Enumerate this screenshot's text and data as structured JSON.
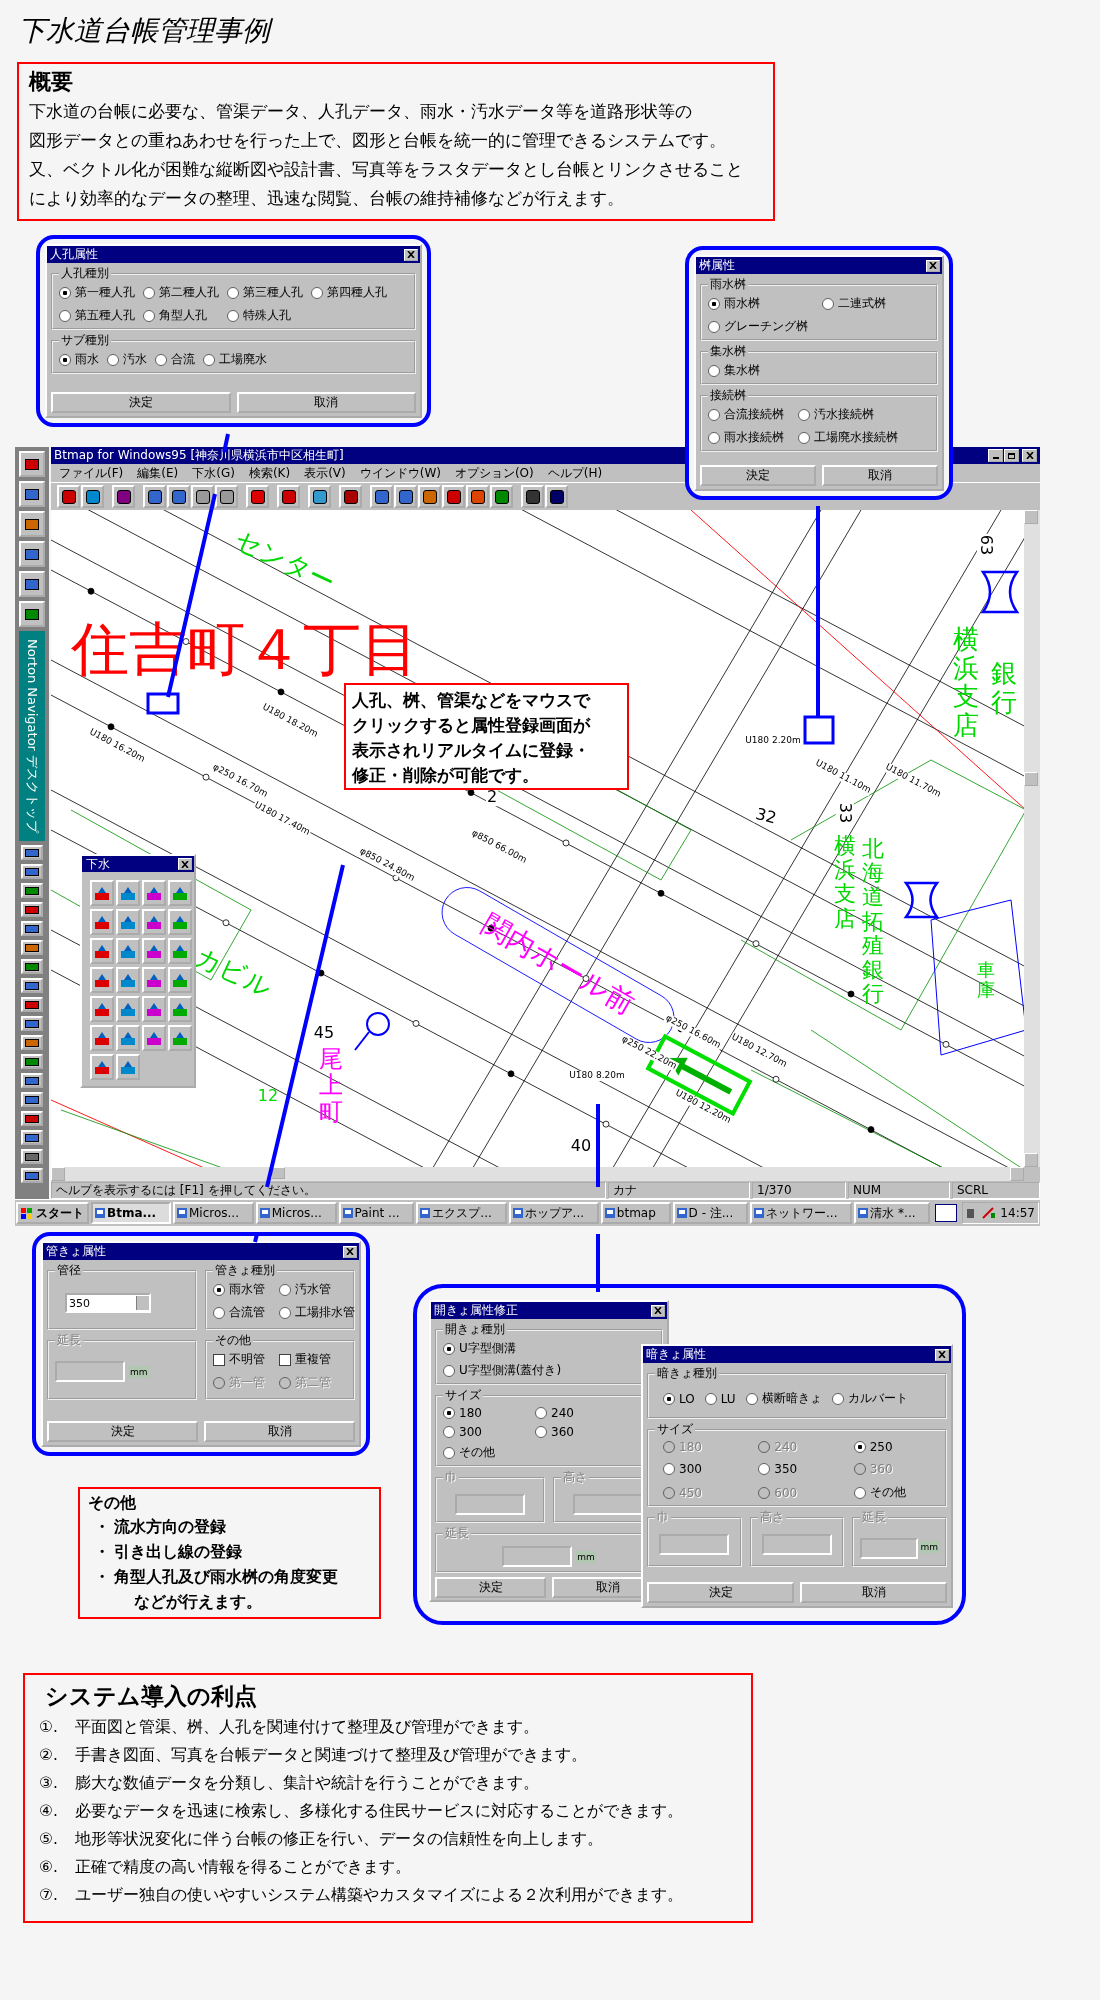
{
  "page_title": "下水道台帳管理事例",
  "overview": {
    "heading": "概要",
    "lines": [
      "下水道の台帳に必要な、管渠データ、人孔データ、雨水・汚水データ等を道路形状等の",
      "図形データとの重ねあわせを行った上で、図形と台帳を統一的に管理できるシステムです。",
      "又、ベクトル化が困難な縦断図や設計書、写真等をラスタデータとし台帳とリンクさせること",
      "により効率的なデータの整理、迅速な閲覧、台帳の維持補修などが行えます。"
    ]
  },
  "manhole_dialog": {
    "title": "人孔属性",
    "groups": [
      {
        "label": "人孔種別",
        "options": [
          {
            "label": "第一種人孔",
            "selected": true
          },
          {
            "label": "第二種人孔",
            "selected": false
          },
          {
            "label": "第三種人孔",
            "selected": false
          },
          {
            "label": "第四種人孔",
            "selected": false
          },
          {
            "label": "第五種人孔",
            "selected": false
          },
          {
            "label": "角型人孔",
            "selected": false
          },
          {
            "label": "特殊人孔",
            "selected": false
          }
        ]
      },
      {
        "label": "サブ種別",
        "options": [
          {
            "label": "雨水",
            "selected": true
          },
          {
            "label": "汚水",
            "selected": false
          },
          {
            "label": "合流",
            "selected": false
          },
          {
            "label": "工場廃水",
            "selected": false
          }
        ]
      }
    ],
    "buttons": [
      "決定",
      "取消"
    ]
  },
  "basin_dialog": {
    "title": "桝属性",
    "groups": [
      {
        "label": "雨水桝",
        "options": [
          {
            "label": "雨水桝",
            "selected": true
          },
          {
            "label": "二連式桝",
            "selected": false
          },
          {
            "label": "グレーチング桝",
            "selected": false
          }
        ]
      },
      {
        "label": "集水桝",
        "options": [
          {
            "label": "集水桝",
            "selected": false
          }
        ]
      },
      {
        "label": "接続桝",
        "options": [
          {
            "label": "合流接続桝",
            "selected": false
          },
          {
            "label": "汚水接続桝",
            "selected": false
          },
          {
            "label": "雨水接続桝",
            "selected": false
          },
          {
            "label": "工場廃水接続桝",
            "selected": false
          }
        ]
      }
    ],
    "buttons": [
      "決定",
      "取消"
    ]
  },
  "app_window": {
    "title": "Btmap for Windows95 [神奈川県横浜市中区相生町]",
    "menu": [
      "ファイル(F)",
      "編集(E)",
      "下水(G)",
      "検索(K)",
      "表示(V)",
      "ウインドウ(W)",
      "オプション(O)",
      "ヘルプ(H)"
    ],
    "map": {
      "labels": [
        {
          "text": "住吉町４丁目",
          "kind": "district"
        },
        {
          "text": "センター",
          "kind": "building"
        },
        {
          "text": "カビル",
          "kind": "building"
        },
        {
          "text": "関内ホール前",
          "kind": "station"
        },
        {
          "text": "尾上町",
          "kind": "station"
        },
        {
          "text": "横浜支店",
          "kind": "building"
        },
        {
          "text": "北海道拓殖銀行",
          "kind": "building"
        },
        {
          "text": "横浜支店",
          "kind": "building"
        },
        {
          "text": "銀行",
          "kind": "building"
        },
        {
          "text": "車庫",
          "kind": "building"
        },
        {
          "text": "63",
          "kind": "lot"
        },
        {
          "text": "33",
          "kind": "lot"
        },
        {
          "text": "32",
          "kind": "lot"
        },
        {
          "text": "2",
          "kind": "lot"
        },
        {
          "text": "45",
          "kind": "lot"
        },
        {
          "text": "12",
          "kind": "building"
        },
        {
          "text": "40",
          "kind": "lot"
        },
        {
          "text": "U180 16.20m",
          "kind": "pipe"
        },
        {
          "text": "φ250 16.70m",
          "kind": "pipe"
        },
        {
          "text": "U180 17.40m",
          "kind": "pipe"
        },
        {
          "text": "φ850 24.80m",
          "kind": "pipe"
        },
        {
          "text": "φ850 66.00m",
          "kind": "pipe"
        },
        {
          "text": "U180 8.20m",
          "kind": "pipe"
        },
        {
          "text": "φ250 22.20m",
          "kind": "pipe"
        },
        {
          "text": "U180 12.20m",
          "kind": "pipe"
        },
        {
          "text": "U180 12.70m",
          "kind": "pipe"
        },
        {
          "text": "U180 11.10m",
          "kind": "pipe"
        },
        {
          "text": "U180 11.70m",
          "kind": "pipe"
        },
        {
          "text": "U180 2.20m",
          "kind": "pipe"
        },
        {
          "text": "φ250 16.60m",
          "kind": "pipe"
        },
        {
          "text": "U180 18.20m",
          "kind": "pipe"
        }
      ],
      "callout": [
        "人孔、桝、管渠などをマウスで",
        "クリックすると属性登録画面が",
        "表示されリアルタイムに登録・",
        "修正・削除が可能です。"
      ]
    },
    "palette": {
      "title": "下水"
    },
    "status_bar": [
      "ヘルプを表示するには [F1] を押してください。",
      "カナ",
      "1/370",
      "NUM",
      "SCRL"
    ]
  },
  "desktop": {
    "navigator_label": "Norton Navigator デスクトップ",
    "taskbar": {
      "start": "スタート",
      "tasks": [
        {
          "label": "Btma...",
          "selected": true
        },
        {
          "label": "Micros...",
          "selected": false
        },
        {
          "label": "Micros...",
          "selected": false
        },
        {
          "label": "Paint ...",
          "selected": false
        },
        {
          "label": "エクスプ...",
          "selected": false
        },
        {
          "label": "ホップア...",
          "selected": false
        },
        {
          "label": "btmap",
          "selected": false
        },
        {
          "label": "D - 注...",
          "selected": false
        },
        {
          "label": "ネットワー...",
          "selected": false
        },
        {
          "label": "清水 *...",
          "selected": false
        }
      ],
      "clock": "14:57"
    }
  },
  "pipe_dialog": {
    "title": "管きょ属性",
    "diameter": {
      "label": "管径",
      "value": "350"
    },
    "type": {
      "label": "管きょ種別",
      "options": [
        {
          "label": "雨水管",
          "selected": true
        },
        {
          "label": "汚水管",
          "selected": false
        },
        {
          "label": "合流管",
          "selected": false
        },
        {
          "label": "工場排水管",
          "selected": false
        }
      ]
    },
    "length": {
      "label": "延長",
      "unit": "mm",
      "disabled": true
    },
    "other": {
      "label": "その他",
      "checks": [
        {
          "label": "不明管",
          "checked": false
        },
        {
          "label": "重複管",
          "checked": false
        }
      ],
      "options": [
        {
          "label": "第一管",
          "selected": false,
          "disabled": true
        },
        {
          "label": "第二管",
          "selected": false,
          "disabled": true
        }
      ]
    },
    "buttons": [
      "決定",
      "取消"
    ]
  },
  "notes": {
    "heading": "その他",
    "items": [
      {
        "bullet": "・",
        "text": "流水方向の登録"
      },
      {
        "bullet": "・",
        "text": "引き出し線の登録"
      },
      {
        "bullet": "・",
        "text": "角型人孔及び雨水桝の角度変更"
      }
    ],
    "tail": "などが行えます。"
  },
  "open_channel_dialog": {
    "title": "開きょ属性修正",
    "type": {
      "label": "開きょ種別",
      "options": [
        {
          "label": "U字型側溝",
          "selected": true
        },
        {
          "label": "U字型側溝(蓋付き)",
          "selected": false
        }
      ]
    },
    "size": {
      "label": "サイズ",
      "options": [
        {
          "label": "180",
          "selected": true
        },
        {
          "label": "240",
          "selected": false
        },
        {
          "label": "300",
          "selected": false
        },
        {
          "label": "360",
          "selected": false
        },
        {
          "label": "その他",
          "selected": false
        }
      ]
    },
    "width": {
      "label": "巾",
      "disabled": true
    },
    "height": {
      "label": "高さ",
      "disabled": true
    },
    "length": {
      "label": "延長",
      "unit": "mm",
      "disabled": true
    },
    "buttons": [
      "決定",
      "取消"
    ]
  },
  "culvert_dialog": {
    "title": "暗きょ属性",
    "type": {
      "label": "暗きょ種別",
      "options": [
        {
          "label": "LO",
          "selected": true
        },
        {
          "label": "LU",
          "selected": false
        },
        {
          "label": "横断暗きょ",
          "selected": false
        },
        {
          "label": "カルバート",
          "selected": false
        }
      ]
    },
    "size": {
      "label": "サイズ",
      "options": [
        {
          "label": "180",
          "selected": false,
          "disabled": true
        },
        {
          "label": "240",
          "selected": false,
          "disabled": true
        },
        {
          "label": "250",
          "selected": true,
          "disabled": false
        },
        {
          "label": "300",
          "selected": false,
          "disabled": false
        },
        {
          "label": "350",
          "selected": false,
          "disabled": false
        },
        {
          "label": "360",
          "selected": false,
          "disabled": true
        },
        {
          "label": "450",
          "selected": false,
          "disabled": true
        },
        {
          "label": "600",
          "selected": false,
          "disabled": true
        },
        {
          "label": "その他",
          "selected": false,
          "disabled": false
        }
      ]
    },
    "width": {
      "label": "巾",
      "disabled": true
    },
    "height": {
      "label": "高さ",
      "disabled": true
    },
    "length": {
      "label": "延長",
      "unit": "mm",
      "disabled": true
    },
    "buttons": [
      "決定",
      "取消"
    ]
  },
  "benefits": {
    "heading": "システム導入の利点",
    "items": [
      {
        "number": "①.",
        "text": "平面図と管渠、桝、人孔を関連付けて整理及び管理ができます。"
      },
      {
        "number": "②.",
        "text": "手書き図面、写真を台帳データと関連づけて整理及び管理ができます。"
      },
      {
        "number": "③.",
        "text": "膨大な数値データを分類し、集計や統計を行うことができます。"
      },
      {
        "number": "④.",
        "text": "必要なデータを迅速に検索し、多様化する住民サービスに対応することができます。"
      },
      {
        "number": "⑤.",
        "text": "地形等状況変化に伴う台帳の修正を行い、データの信頼性を向上します。"
      },
      {
        "number": "⑥.",
        "text": "正確で精度の高い情報を得ることができます。"
      },
      {
        "number": "⑦.",
        "text": "ユーザー独自の使いやすいシステム構築やカスタマイズによる２次利用ができます。"
      }
    ]
  }
}
